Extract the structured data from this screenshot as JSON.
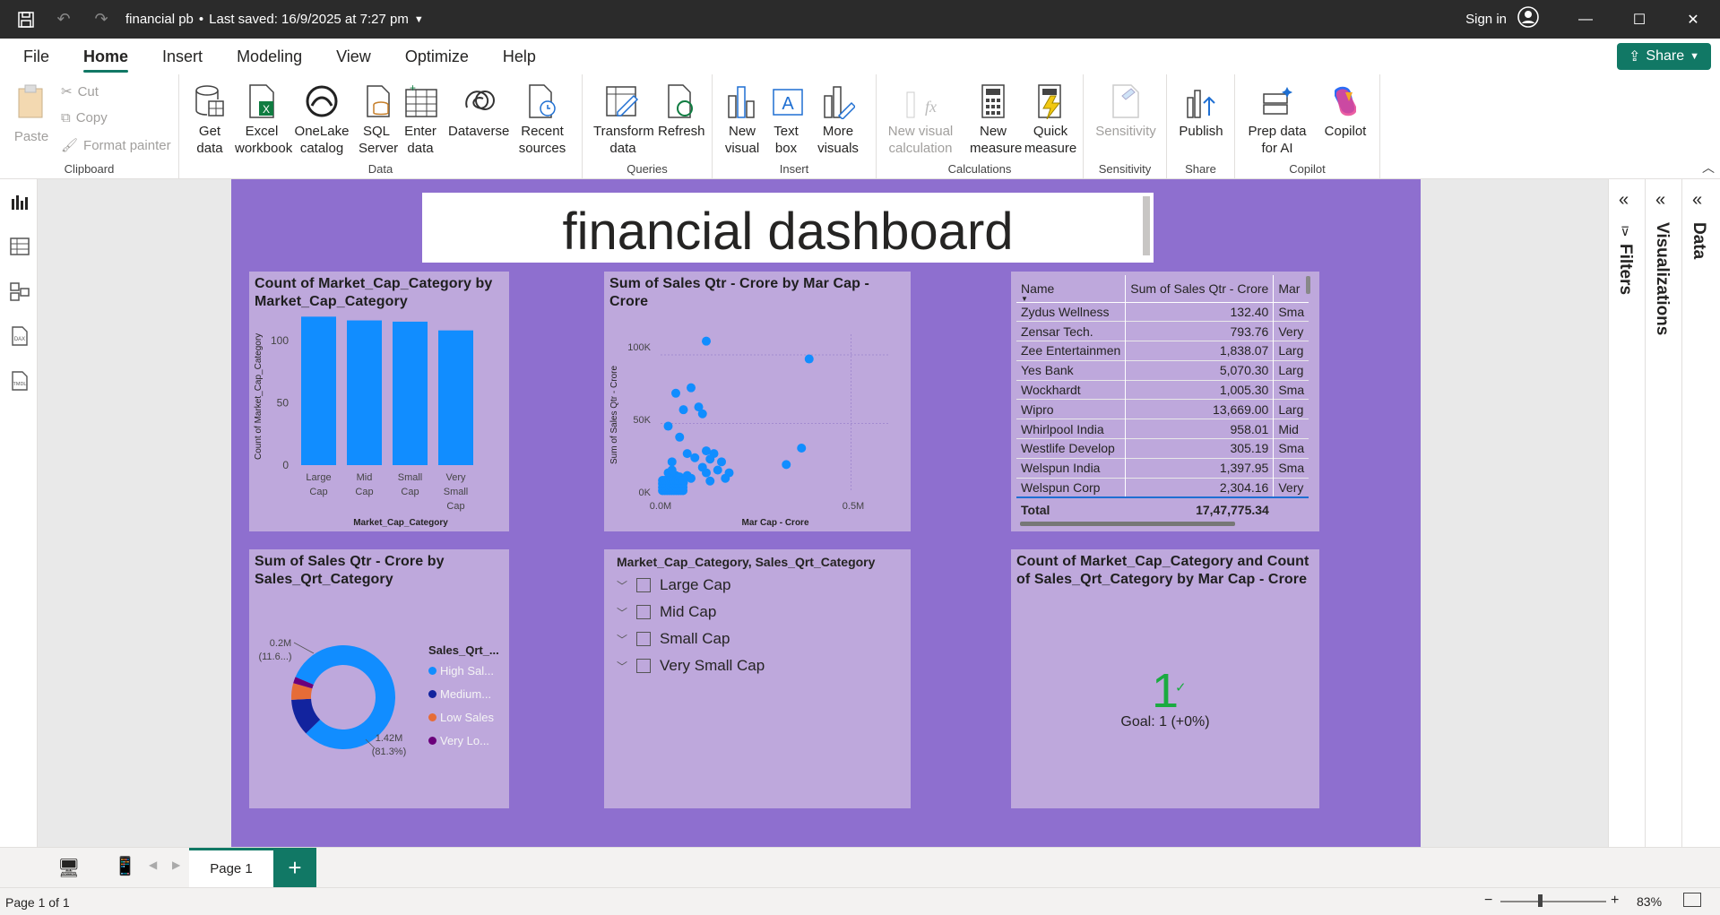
{
  "titlebar": {
    "doc_title": "financial pb",
    "saved": "Last saved: 16/9/2025 at 7:27 pm",
    "signin": "Sign in"
  },
  "menu": [
    "File",
    "Home",
    "Insert",
    "Modeling",
    "View",
    "Optimize",
    "Help"
  ],
  "share": "Share",
  "ribbon": {
    "clipboard": {
      "paste": "Paste",
      "cut": "Cut",
      "copy": "Copy",
      "format_painter": "Format painter",
      "label": "Clipboard"
    },
    "data": {
      "get_data": "Get data",
      "excel": "Excel workbook",
      "onelake": "OneLake catalog",
      "sql": "SQL Server",
      "enter": "Enter data",
      "dataverse": "Dataverse",
      "recent": "Recent sources",
      "label": "Data"
    },
    "queries": {
      "transform": "Transform data",
      "refresh": "Refresh",
      "label": "Queries"
    },
    "insert": {
      "new_visual": "New visual",
      "text_box": "Text box",
      "more_visuals": "More visuals",
      "label": "Insert"
    },
    "calculations": {
      "new_visual_calc": "New visual calculation",
      "new_measure": "New measure",
      "quick_measure": "Quick measure",
      "label": "Calculations"
    },
    "sensitivity": {
      "btn": "Sensitivity",
      "label": "Sensitivity"
    },
    "share": {
      "publish": "Publish",
      "label": "Share"
    },
    "copilot": {
      "prep": "Prep data for AI",
      "copilot": "Copilot",
      "label": "Copilot"
    }
  },
  "report_title": "financial dashboard",
  "bar_visual": {
    "title": "Count of Market_Cap_Category by Market_Cap_Category",
    "ylabel": "Count of Market_Cap_Category",
    "xlabel": "Market_Cap_Category",
    "yticks": [
      "100",
      "50",
      "0"
    ],
    "categories": [
      "Large Cap",
      "Mid Cap",
      "Small Cap",
      "Very Small Cap"
    ],
    "color": "#118dff"
  },
  "scatter_visual": {
    "title": "Sum of Sales Qtr - Crore by Mar Cap - Crore",
    "ylabel": "Sum of Sales Qtr - Crore",
    "xlabel": "Mar Cap - Crore",
    "yticks": [
      "100K",
      "50K",
      "0K"
    ],
    "xticks": [
      "0.0M",
      "0.5M"
    ]
  },
  "table_visual": {
    "headers": [
      "Name",
      "Sum of Sales Qtr - Crore",
      "Mar"
    ],
    "rows": [
      [
        "Zydus Wellness",
        "132.40",
        "Sma"
      ],
      [
        "Zensar Tech.",
        "793.76",
        "Very"
      ],
      [
        "Zee Entertainmen",
        "1,838.07",
        "Larg"
      ],
      [
        "Yes Bank",
        "5,070.30",
        "Larg"
      ],
      [
        "Wockhardt",
        "1,005.30",
        "Sma"
      ],
      [
        "Wipro",
        "13,669.00",
        "Larg"
      ],
      [
        "Whirlpool India",
        "958.01",
        "Mid"
      ],
      [
        "Westlife Develop",
        "305.19",
        "Sma"
      ],
      [
        "Welspun India",
        "1,397.95",
        "Sma"
      ],
      [
        "Welspun Corp",
        "2,304.16",
        "Very"
      ]
    ],
    "total_label": "Total",
    "total_value": "17,47,775.34"
  },
  "donut_visual": {
    "title": "Sum of Sales Qtr - Crore by Sales_Qrt_Category",
    "legend_title": "Sales_Qrt_...",
    "legend": [
      {
        "label": "High Sal...",
        "color": "#118dff"
      },
      {
        "label": "Medium...",
        "color": "#12239e"
      },
      {
        "label": "Low Sales",
        "color": "#e66c37"
      },
      {
        "label": "Very Lo...",
        "color": "#6b007b"
      }
    ],
    "label_small_value": "0.2M",
    "label_small_pct": "(11.6...)",
    "label_large_value": "1.42M",
    "label_large_pct": "(81.3%)"
  },
  "slicer_visual": {
    "title": "Market_Cap_Category, Sales_Qrt_Category",
    "items": [
      "Large Cap",
      "Mid Cap",
      "Small Cap",
      "Very Small Cap"
    ]
  },
  "kpi_visual": {
    "title": "Count of Market_Cap_Category and Count of Sales_Qrt_Category by Mar Cap - Crore",
    "value": "1",
    "goal": "Goal: 1 (+0%)",
    "value_color": "#1aab40"
  },
  "right_panels": [
    "Filters",
    "Visualizations",
    "Data"
  ],
  "page_tab": "Page 1",
  "status": {
    "page": "Page 1 of 1",
    "zoom": "83%"
  },
  "chart_data": [
    {
      "type": "bar",
      "title": "Count of Market_Cap_Category by Market_Cap_Category",
      "categories": [
        "Large Cap",
        "Mid Cap",
        "Small Cap",
        "Very Small Cap"
      ],
      "values": [
        119,
        116,
        115,
        108
      ],
      "xlabel": "Market_Cap_Category",
      "ylabel": "Count of Market_Cap_Category",
      "ylim": [
        0,
        125
      ]
    },
    {
      "type": "scatter",
      "title": "Sum of Sales Qtr - Crore by Mar Cap - Crore",
      "xlabel": "Mar Cap - Crore",
      "ylabel": "Sum of Sales Qtr - Crore",
      "xlim": [
        0,
        0.6
      ],
      "ylim": [
        0,
        115
      ],
      "x": [
        0.12,
        0.04,
        0.08,
        0.02,
        0.06,
        0.11,
        0.1,
        0.05,
        0.03,
        0.07,
        0.09,
        0.12,
        0.14,
        0.13,
        0.16,
        0.11,
        0.15,
        0.12,
        0.18,
        0.13,
        0.17,
        0.33,
        0.37,
        0.39,
        0.01,
        0.02,
        0.03,
        0.04,
        0.05,
        0.06,
        0.01,
        0.02,
        0.03,
        0.04,
        0.02,
        0.03,
        0.05,
        0.06,
        0.07,
        0.01,
        0.08,
        0.03
      ],
      "y": [
        110,
        72,
        76,
        48,
        60,
        57,
        62,
        40,
        22,
        28,
        25,
        30,
        28,
        24,
        22,
        18,
        16,
        14,
        14,
        8,
        10,
        20,
        32,
        97,
        2,
        3,
        4,
        5,
        6,
        7,
        8,
        9,
        10,
        12,
        14,
        15,
        11,
        9,
        12,
        6,
        10,
        16
      ]
    },
    {
      "type": "pie",
      "title": "Sum of Sales Qtr - Crore by Sales_Qrt_Category",
      "categories": [
        "High Sal...",
        "Medium...",
        "Low Sales",
        "Very Lo..."
      ],
      "values": [
        1.42,
        0.2,
        0.09,
        0.035
      ]
    }
  ]
}
